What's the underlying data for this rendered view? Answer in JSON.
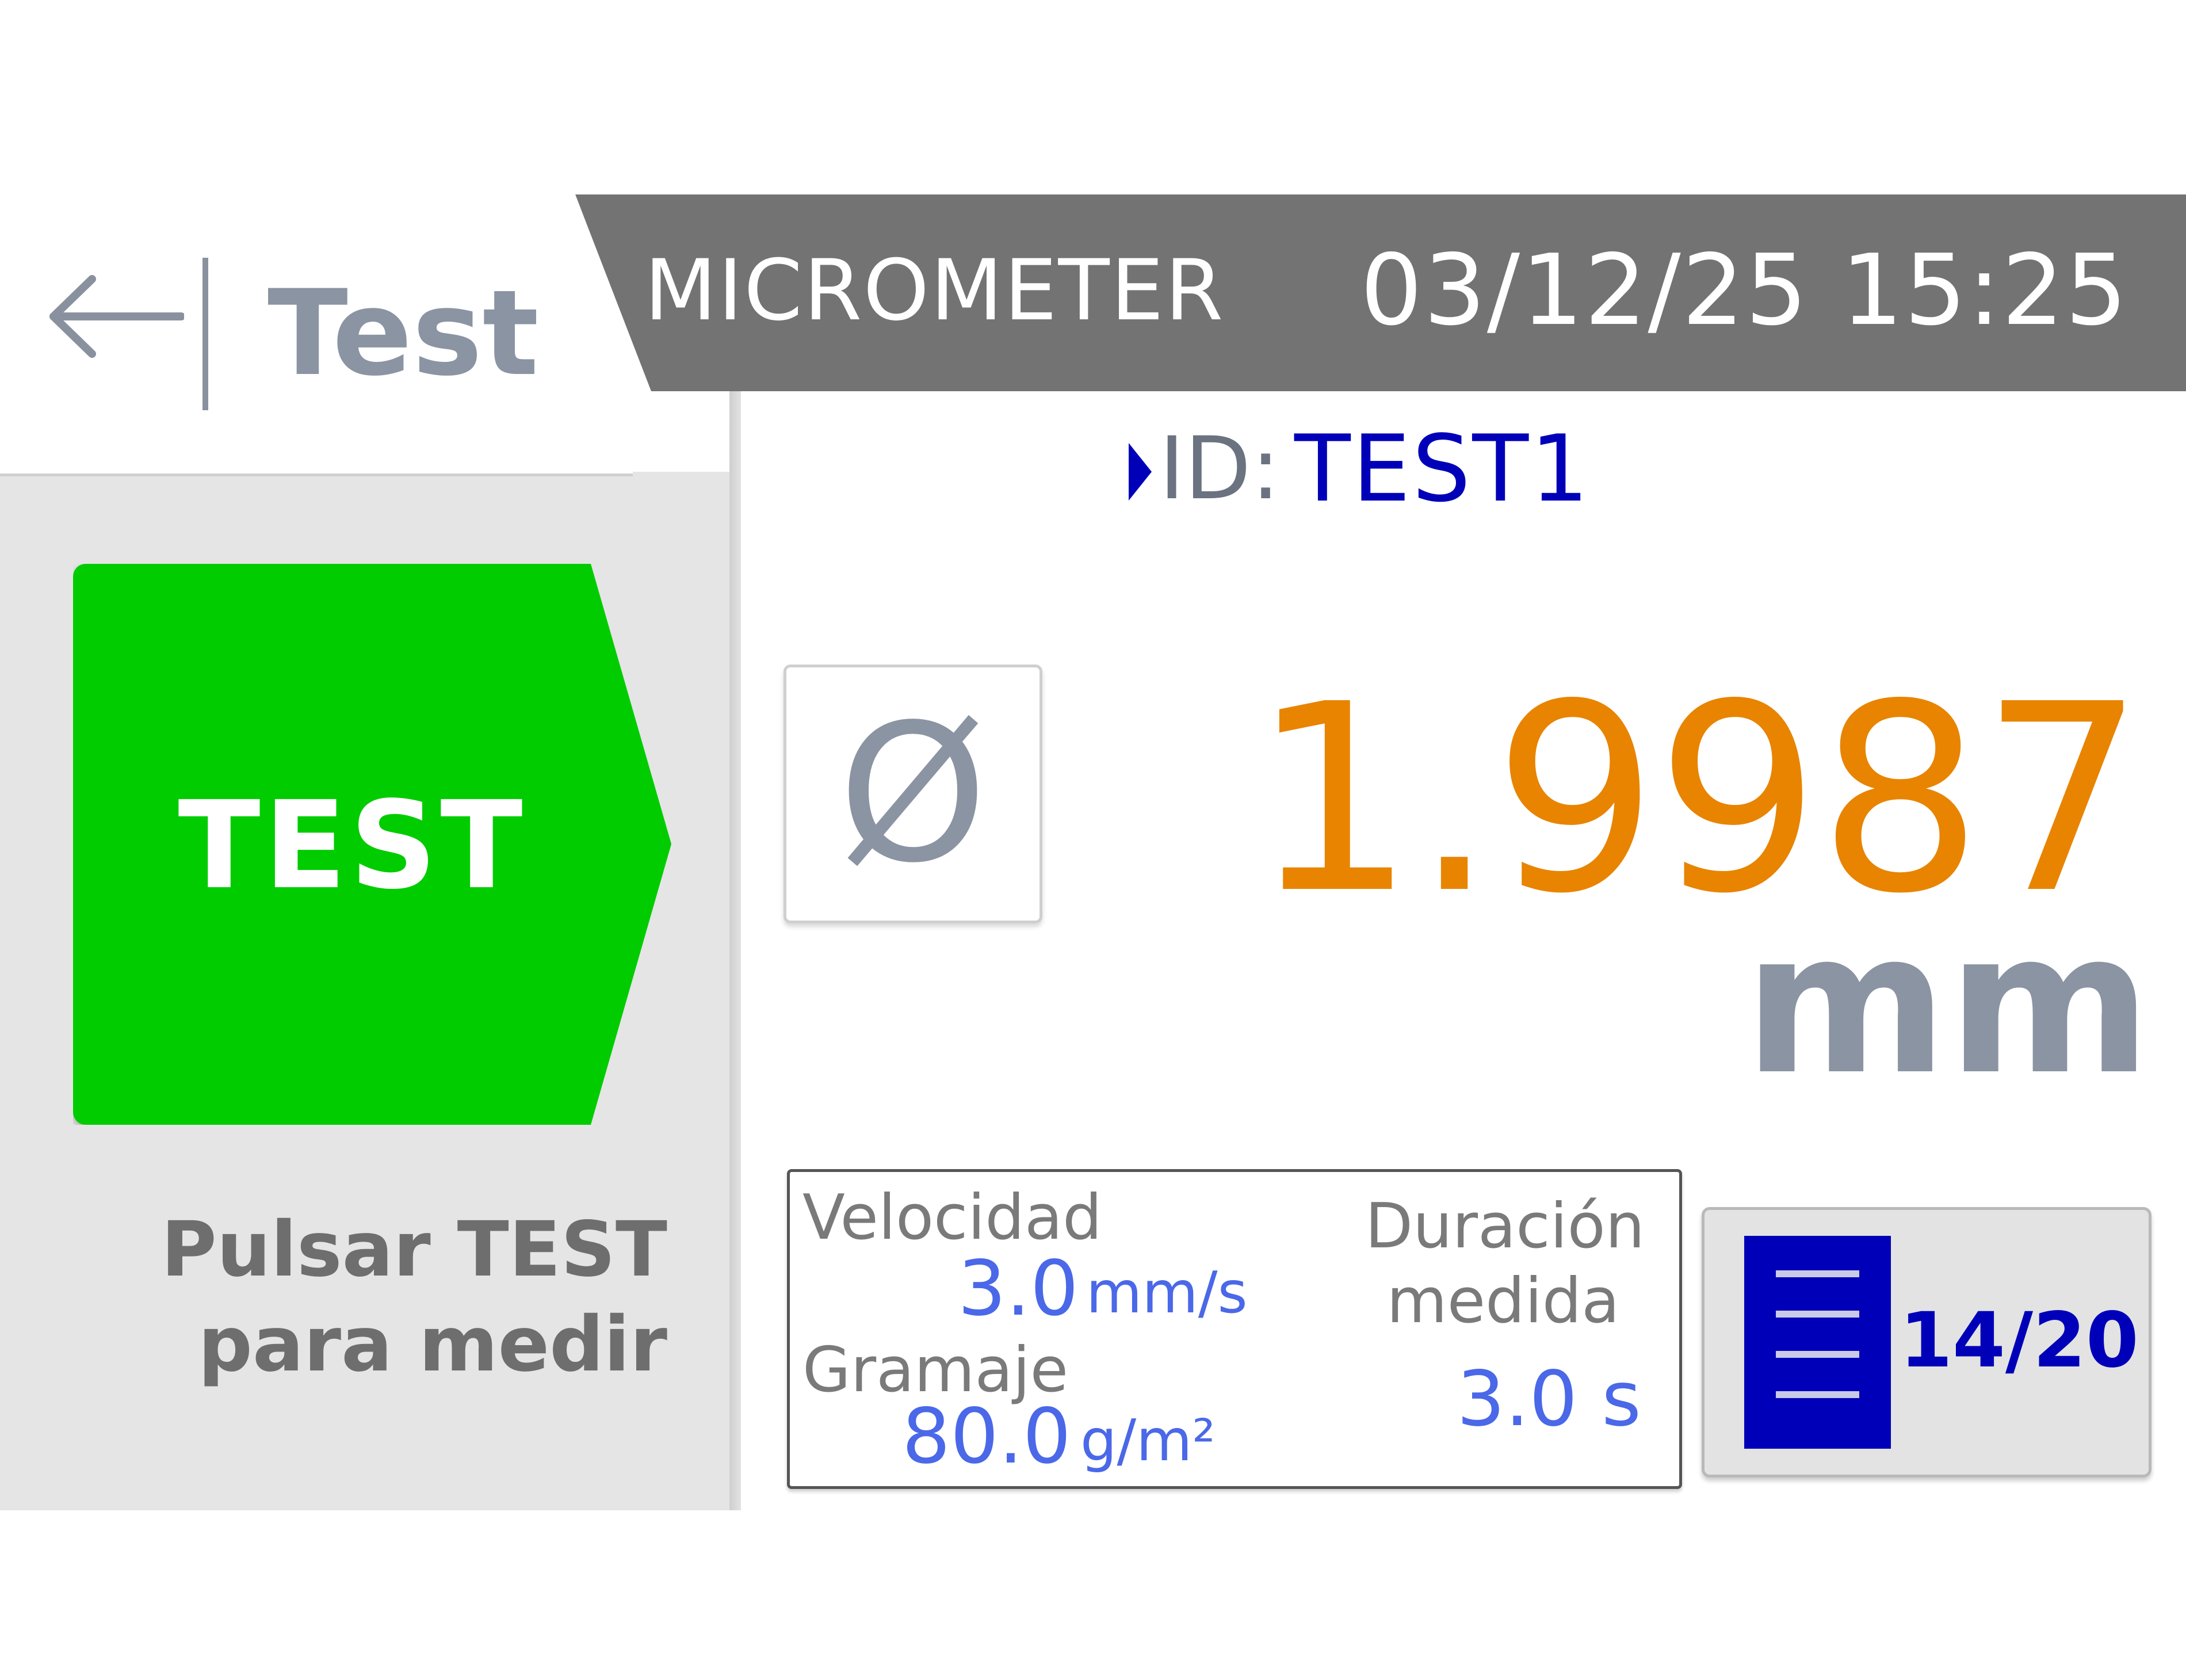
{
  "header": {
    "title": "MICROMETER",
    "datetime": "03/12/25 15:25"
  },
  "back_tab": {
    "icon": "back-arrow-icon",
    "label": "Test"
  },
  "test_button": {
    "label": "TEST",
    "color": "#00cc00"
  },
  "hint": {
    "line1": "Pulsar TEST",
    "line2": "para medir"
  },
  "sample": {
    "id_label": "ID:",
    "id_value": "TEST1"
  },
  "diameter_button": {
    "icon": "diameter-icon",
    "symbol": "Ø"
  },
  "reading": {
    "value": "1.9987",
    "unit": "mm",
    "color": "#e88400"
  },
  "params": {
    "speed_label": "Velocidad",
    "speed_value": "3.0",
    "speed_unit": "mm/s",
    "grammage_label": "Gramaje",
    "grammage_value": "80.0",
    "grammage_unit": "g/m²",
    "duration_label_line1": "Duración",
    "duration_label_line2": "medida",
    "duration_value": "3.0 s"
  },
  "list_button": {
    "icon": "list-icon",
    "count": "14/20"
  }
}
